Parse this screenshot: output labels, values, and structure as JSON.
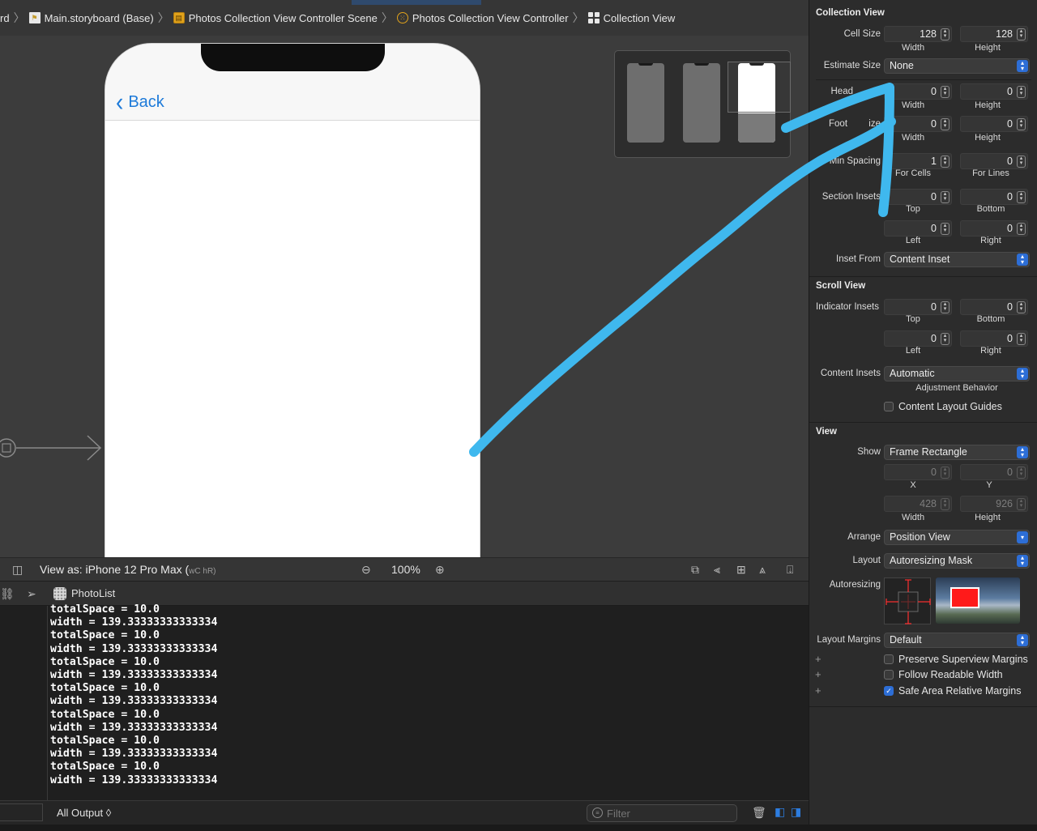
{
  "breadcrumb": {
    "items": [
      {
        "label": "rd"
      },
      {
        "label": "Main.storyboard (Base)"
      },
      {
        "label": "Photos Collection View Controller Scene"
      },
      {
        "label": "Photos Collection View Controller"
      },
      {
        "label": "Collection View"
      }
    ]
  },
  "canvas": {
    "back_label": "Back",
    "view_as": "View as: iPhone 12 Pro Max (",
    "view_as_suffix": "wC hR)",
    "zoom": "100%"
  },
  "debug": {
    "target_label": "PhotoList"
  },
  "console": {
    "lines": [
      "totalSpace = 10.0",
      "width = 139.33333333333334",
      "totalSpace = 10.0",
      "width = 139.33333333333334",
      "totalSpace = 10.0",
      "width = 139.33333333333334",
      "totalSpace = 10.0",
      "width = 139.33333333333334",
      "totalSpace = 10.0",
      "width = 139.33333333333334",
      "totalSpace = 10.0",
      "width = 139.33333333333334",
      "totalSpace = 10.0",
      "width = 139.33333333333334"
    ],
    "output_selector": "All Output ◊",
    "filter_placeholder": "Filter"
  },
  "inspector": {
    "collection_view": {
      "title": "Collection View",
      "cell_size_label": "Cell Size",
      "cell_width": "128",
      "cell_height": "128",
      "estimate_size_label": "Estimate Size",
      "estimate_size_value": "None",
      "header_label": "Head",
      "header_width": "0",
      "header_height": "0",
      "footer_label_a": "Foot",
      "footer_label_b": "ize",
      "footer_width": "0",
      "footer_height": "0",
      "min_spacing_label": "Min Spacing",
      "min_spacing_cells": "1",
      "min_spacing_lines": "0",
      "for_cells": "For Cells",
      "for_lines": "For Lines",
      "section_insets_label": "Section Insets",
      "inset_top": "0",
      "inset_bottom": "0",
      "inset_left": "0",
      "inset_right": "0",
      "inset_from_label": "Inset From",
      "inset_from_value": "Content Inset"
    },
    "scroll_view": {
      "title": "Scroll View",
      "indicator_insets_label": "Indicator Insets",
      "top": "0",
      "bottom": "0",
      "left": "0",
      "right": "0",
      "content_insets_label": "Content Insets",
      "content_insets_value": "Automatic",
      "adjustment_behavior": "Adjustment Behavior",
      "content_layout_guides": "Content Layout Guides"
    },
    "view": {
      "title": "View",
      "show_label": "Show",
      "show_value": "Frame Rectangle",
      "x": "0",
      "y": "0",
      "width": "428",
      "height": "926",
      "arrange_label": "Arrange",
      "arrange_value": "Position View",
      "layout_label": "Layout",
      "layout_value": "Autoresizing Mask",
      "autoresizing_label": "Autoresizing",
      "layout_margins_label": "Layout Margins",
      "layout_margins_value": "Default",
      "preserve_superview": "Preserve Superview Margins",
      "follow_readable": "Follow Readable Width",
      "safe_area_relative": "Safe Area Relative Margins"
    },
    "sub_labels": {
      "width": "Width",
      "height": "Height",
      "top": "Top",
      "bottom": "Bottom",
      "left": "Left",
      "right": "Right",
      "x": "X",
      "y": "Y"
    }
  },
  "colors": {
    "annotation_arrow": "#3fb8ee",
    "accent": "#2d6ed6",
    "ios_tint": "#1d7ad9"
  }
}
